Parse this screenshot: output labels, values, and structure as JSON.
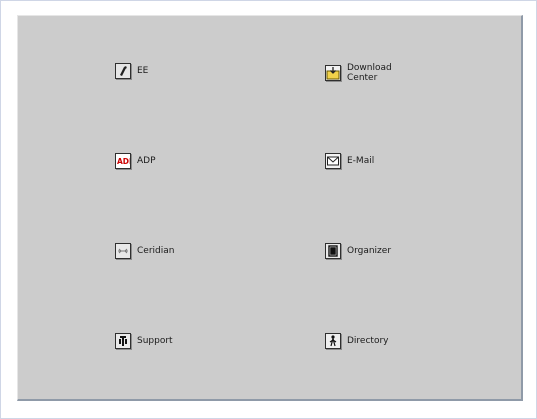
{
  "launchers": {
    "ee": {
      "label": "EE",
      "icon": "ee-icon"
    },
    "download": {
      "label": "Download\nCenter",
      "icon": "download-center-icon"
    },
    "adp": {
      "label": "ADP",
      "icon": "adp-logo-icon"
    },
    "email": {
      "label": "E-Mail",
      "icon": "mail-icon"
    },
    "ceridian": {
      "label": "Ceridian",
      "icon": "ceridian-icon"
    },
    "organizer": {
      "label": "Organizer",
      "icon": "organizer-icon"
    },
    "support": {
      "label": "Support",
      "icon": "support-icon"
    },
    "directory": {
      "label": "Directory",
      "icon": "directory-icon"
    }
  },
  "colors": {
    "panel": "#cccccc",
    "panel_shadow": "#8f9aa8",
    "adp_red": "#cc0000"
  }
}
